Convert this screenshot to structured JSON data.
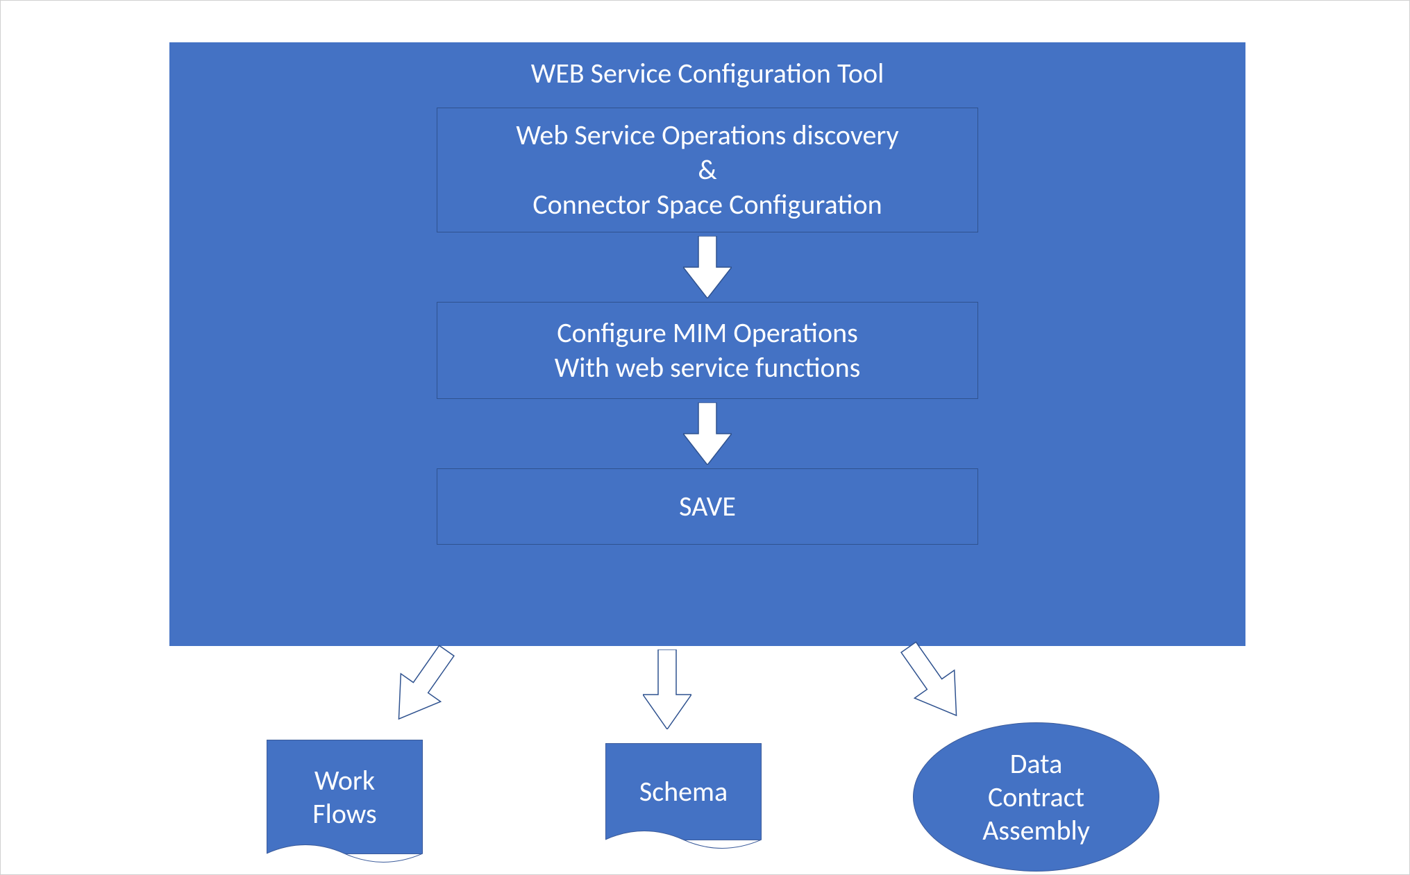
{
  "colors": {
    "primary": "#4472C4",
    "border": "#2F528F",
    "arrow_fill": "#FFFFFF",
    "text_light": "#FFFFFF"
  },
  "main": {
    "title": "WEB Service Configuration Tool",
    "step1": {
      "line1": "Web Service Operations discovery",
      "line2": "&",
      "line3": "Connector Space Configuration"
    },
    "step2": {
      "line1": "Configure MIM Operations",
      "line2": "With web service functions"
    },
    "step3": {
      "line1": "SAVE"
    }
  },
  "outputs": {
    "workflows": {
      "line1": "Work",
      "line2": "Flows"
    },
    "schema": {
      "line1": "Schema"
    },
    "data_contract": {
      "line1": "Data",
      "line2": "Contract",
      "line3": "Assembly"
    }
  }
}
